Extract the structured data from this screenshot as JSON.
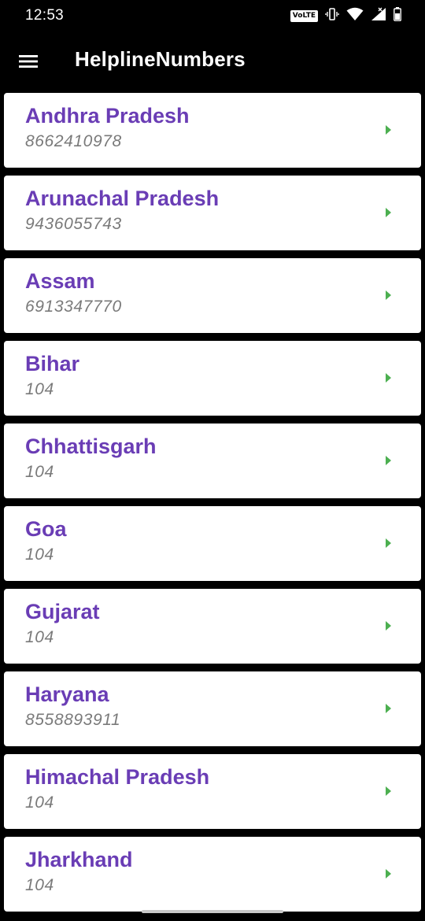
{
  "status_bar": {
    "time": "12:53",
    "volte_label": "VoLTE",
    "icons": [
      "volte-icon",
      "vibrate-icon",
      "wifi-icon",
      "signal-icon",
      "battery-icon"
    ]
  },
  "app_bar": {
    "title": "HelplineNumbers",
    "menu_icon": "hamburger-menu-icon"
  },
  "colors": {
    "background": "#000000",
    "card": "#ffffff",
    "name_text": "#6a3db5",
    "number_text": "#7a7a7a",
    "chevron": "#4caf50"
  },
  "helplines": [
    {
      "state": "Andhra Pradesh",
      "number": "8662410978"
    },
    {
      "state": "Arunachal Pradesh",
      "number": "9436055743"
    },
    {
      "state": "Assam",
      "number": "6913347770"
    },
    {
      "state": "Bihar",
      "number": "104"
    },
    {
      "state": "Chhattisgarh",
      "number": "104"
    },
    {
      "state": "Goa",
      "number": "104"
    },
    {
      "state": "Gujarat",
      "number": "104"
    },
    {
      "state": "Haryana",
      "number": "8558893911"
    },
    {
      "state": "Himachal Pradesh",
      "number": "104"
    },
    {
      "state": "Jharkhand",
      "number": "104"
    }
  ]
}
